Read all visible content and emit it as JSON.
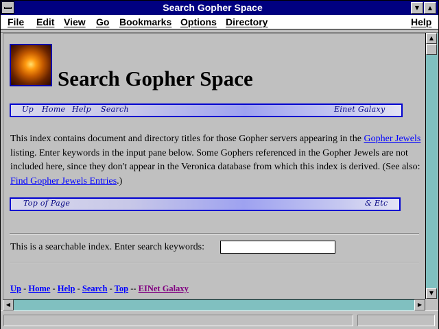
{
  "window": {
    "title": "Search Gopher Space"
  },
  "menu": {
    "items": [
      "File",
      "Edit",
      "View",
      "Go",
      "Bookmarks",
      "Options",
      "Directory"
    ],
    "help": "Help"
  },
  "page": {
    "heading": "Search Gopher Space",
    "nav_top": {
      "links": [
        "Up",
        "Home",
        "Help",
        "Search"
      ],
      "right": "Einet Galaxy"
    },
    "intro": {
      "part1": "This index contains document and directory titles for those Gopher servers appearing in the ",
      "link1": "Gopher Jewels",
      "part2": " listing. Enter keywords in the input pane below. Some Gophers referenced in the Gopher Jewels are not included here, since they don't appear in the Veronica database from which this index is derived. (See also: ",
      "link2": "Find Gopher Jewels Entries",
      "part3": ".)"
    },
    "nav_bottom": {
      "left": "Top of Page",
      "right": "& Etc"
    },
    "search": {
      "prompt": "This is a searchable index. Enter search keywords:",
      "value": ""
    },
    "footer": {
      "links": [
        "Up",
        "Home",
        "Help",
        "Search",
        "Top"
      ],
      "sep": " - ",
      "sep2": " -- ",
      "galaxy": "EINet Galaxy"
    }
  },
  "colors": {
    "titlebar": "#000080",
    "link": "#0000ff",
    "visited_link": "#800080",
    "scrollbar_track": "#80c0c0"
  }
}
